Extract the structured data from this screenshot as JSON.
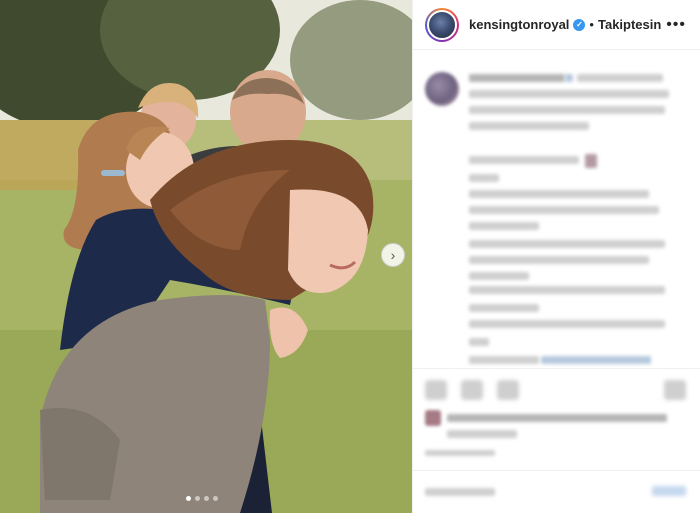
{
  "header": {
    "username": "kensingtonroyal",
    "separator": "•",
    "follow_status": "Takiptesin",
    "more_label": "•••"
  },
  "carousel": {
    "next_label": "›",
    "slide_count": 4,
    "active_slide": 1
  },
  "colors": {
    "verified": "#3897f0",
    "text": "#262626",
    "border": "#efefef"
  },
  "icons": {
    "verified": "verified-badge-icon",
    "next": "chevron-right-icon",
    "more": "more-options-icon"
  }
}
